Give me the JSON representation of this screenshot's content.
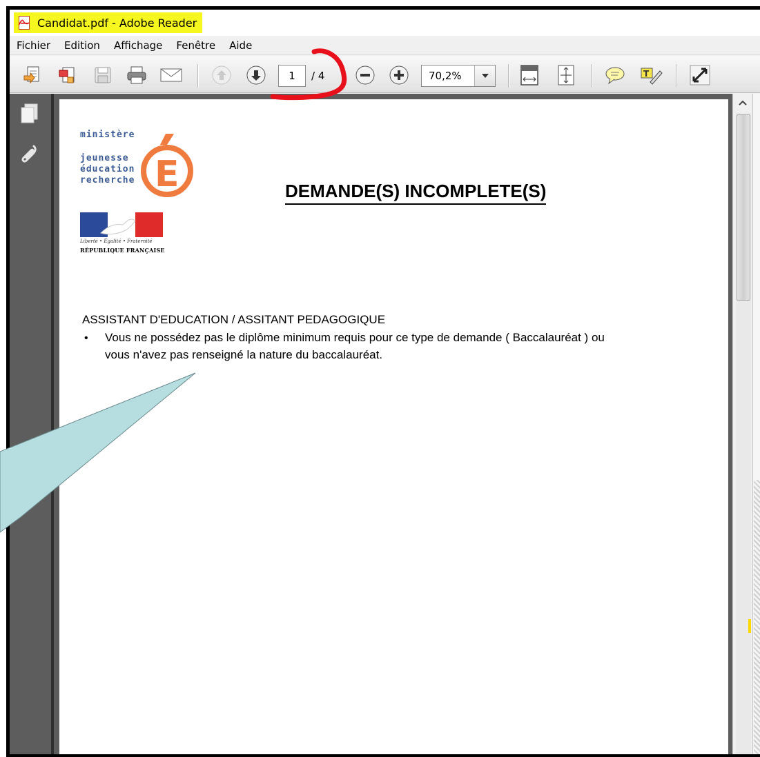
{
  "window": {
    "title": "Candidat.pdf - Adobe Reader",
    "title_highlight_color": "#f7f720"
  },
  "menu": {
    "items": [
      "Fichier",
      "Edition",
      "Affichage",
      "Fenêtre",
      "Aide"
    ]
  },
  "toolbar": {
    "buttons": [
      "create-pdf-icon",
      "export-pdf-icon",
      "save-icon",
      "print-icon",
      "email-icon",
      "previous-page-icon",
      "next-page-icon",
      "zoom-out-icon",
      "zoom-in-icon",
      "fit-width-icon",
      "fit-page-icon",
      "comment-icon",
      "highlight-text-icon",
      "full-screen-icon"
    ],
    "current_page": "1",
    "page_total": "/ 4",
    "zoom": "70,2%",
    "annotation_color": "#e8101a"
  },
  "nav_panel": {
    "icons": [
      "pages-icon",
      "attachments-icon"
    ]
  },
  "document": {
    "logo": {
      "lines": [
        "ministère",
        "jeunesse",
        "éducation",
        "recherche"
      ],
      "emblem_letter": "É",
      "emblem_color": "#ef7b3f",
      "motto": "Liberté • Égalité • Fraternité",
      "republic": "RÉPUBLIQUE FRANÇAISE"
    },
    "heading": "DEMANDE(S) INCOMPLETE(S)",
    "section_title": "ASSISTANT D'EDUCATION / ASSITANT PEDAGOGIQUE",
    "bullet": "•",
    "bullet_text_line1": "Vous ne possédez pas le diplôme minimum requis pour ce type de demande ( Baccalauréat ) ou",
    "bullet_text_line2": "vous n'avez pas renseigné la nature du baccalauréat."
  },
  "callout": {
    "fill_color": "#b6dde0"
  }
}
